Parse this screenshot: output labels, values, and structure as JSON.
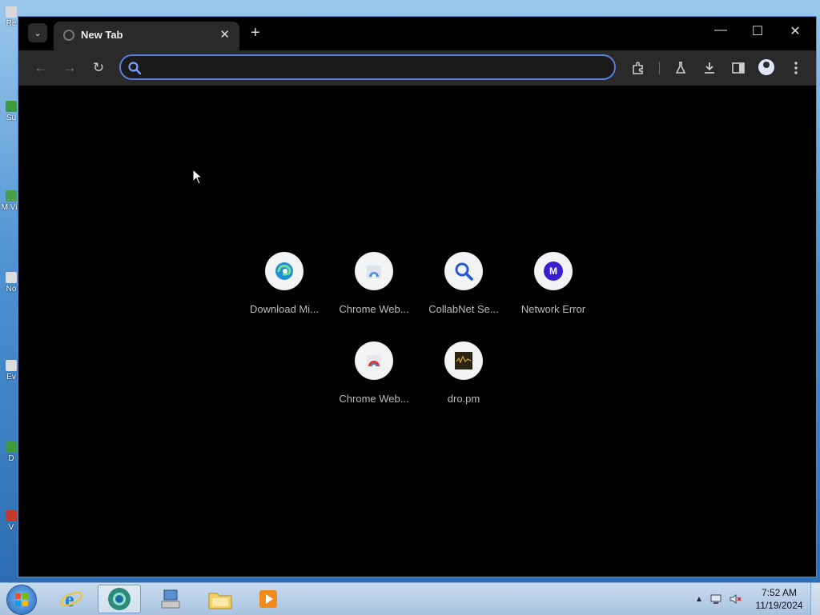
{
  "desktop": {
    "icons": [
      {
        "label": "Re",
        "color": "#c0c0c0"
      },
      {
        "label": "Su",
        "color": "#3c9b3c"
      },
      {
        "label": "M\nVis",
        "color": "#4aa04a"
      },
      {
        "label": "No",
        "color": "#dcdcdc"
      },
      {
        "label": "Ev",
        "color": "#dcdcdc"
      },
      {
        "label": "D",
        "color": "#3c9b3c"
      },
      {
        "label": "V",
        "color": "#c23a2a"
      }
    ]
  },
  "browser": {
    "tab": {
      "title": "New Tab",
      "close_glyph": "✕"
    },
    "tab_menu_glyph": "⌄",
    "new_tab_glyph": "+",
    "window_controls": {
      "minimize": "—",
      "maximize": "☐",
      "close": "✕"
    },
    "nav": {
      "back": "←",
      "forward": "→",
      "reload": "↻"
    },
    "omnibox": {
      "value": "",
      "placeholder": ""
    },
    "toolbar_icons": [
      "extensions-icon",
      "labs-flask-icon",
      "download-icon",
      "side-panel-icon",
      "profile-icon",
      "more-menu-icon"
    ],
    "accent": "#5a7fd8"
  },
  "shortcuts": [
    {
      "name": "Download Mi...",
      "icon": "edge-logo-icon"
    },
    {
      "name": "Chrome Web...",
      "icon": "chrome-web-store-icon"
    },
    {
      "name": "CollabNet Se...",
      "icon": "search-magnifier-icon"
    },
    {
      "name": "Network Error",
      "icon": "letter-m-icon",
      "letter": "M",
      "color": "#3a1fcf"
    },
    {
      "name": "Chrome Web...",
      "icon": "chrome-web-store-colored-icon"
    },
    {
      "name": "dro.pm",
      "icon": "dro-pm-thumbnail-icon"
    }
  ],
  "taskbar": {
    "apps": [
      "internet-explorer-icon",
      "chrome-canary-icon",
      "network-computer-icon",
      "file-explorer-icon",
      "media-player-icon"
    ],
    "clock": {
      "time": "7:52 AM",
      "date": "11/19/2024"
    }
  }
}
